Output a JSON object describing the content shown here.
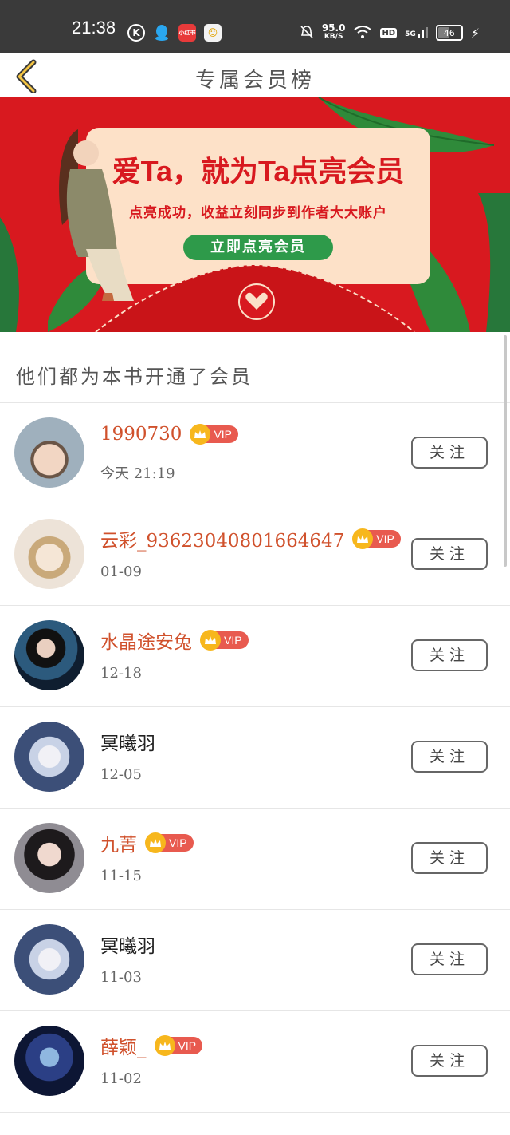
{
  "status_bar": {
    "time": "21:38",
    "net_speed_value": "95.0",
    "net_speed_unit": "KB/S",
    "hd": "HD",
    "signal": "5G",
    "battery": "46",
    "app_badge": "小红书"
  },
  "header": {
    "title": "专属会员榜"
  },
  "banner": {
    "headline": "爱Ta，就为Ta点亮会员",
    "subtitle": "点亮成功，收益立刻同步到作者大大账户",
    "cta": "立即点亮会员"
  },
  "section": {
    "title": "他们都为本书开通了会员"
  },
  "members": [
    {
      "name": "1990730",
      "vip": true,
      "vip_label": "VIP",
      "date": "今天 21:19",
      "follow": "关注",
      "avatar_color": "#9fb0bd"
    },
    {
      "name": "云彩_93623040801664647",
      "vip": true,
      "vip_label": "VIP",
      "date": "01-09",
      "follow": "关注",
      "avatar_color": "#e8d8c6"
    },
    {
      "name": "水晶途安兔",
      "vip": true,
      "vip_label": "VIP",
      "date": "12-18",
      "follow": "关注",
      "avatar_color": "#1d3a55"
    },
    {
      "name": "冥曦羽",
      "vip": false,
      "vip_label": "",
      "date": "12-05",
      "follow": "关注",
      "avatar_color": "#5a6f8e"
    },
    {
      "name": "九菁",
      "vip": true,
      "vip_label": "VIP",
      "date": "11-15",
      "follow": "关注",
      "avatar_color": "#3b3338"
    },
    {
      "name": "冥曦羽",
      "vip": false,
      "vip_label": "",
      "date": "11-03",
      "follow": "关注",
      "avatar_color": "#5a6f8e"
    },
    {
      "name": "薛颖_",
      "vip": true,
      "vip_label": "VIP",
      "date": "11-02",
      "follow": "关注",
      "avatar_color": "#1f2f6a"
    }
  ],
  "colors": {
    "accent_red": "#d8191f",
    "name_orange": "#d0512c",
    "vip_pill": "#e85a4f",
    "crown_gold": "#f7b71d",
    "cta_green": "#2e9a4a"
  }
}
